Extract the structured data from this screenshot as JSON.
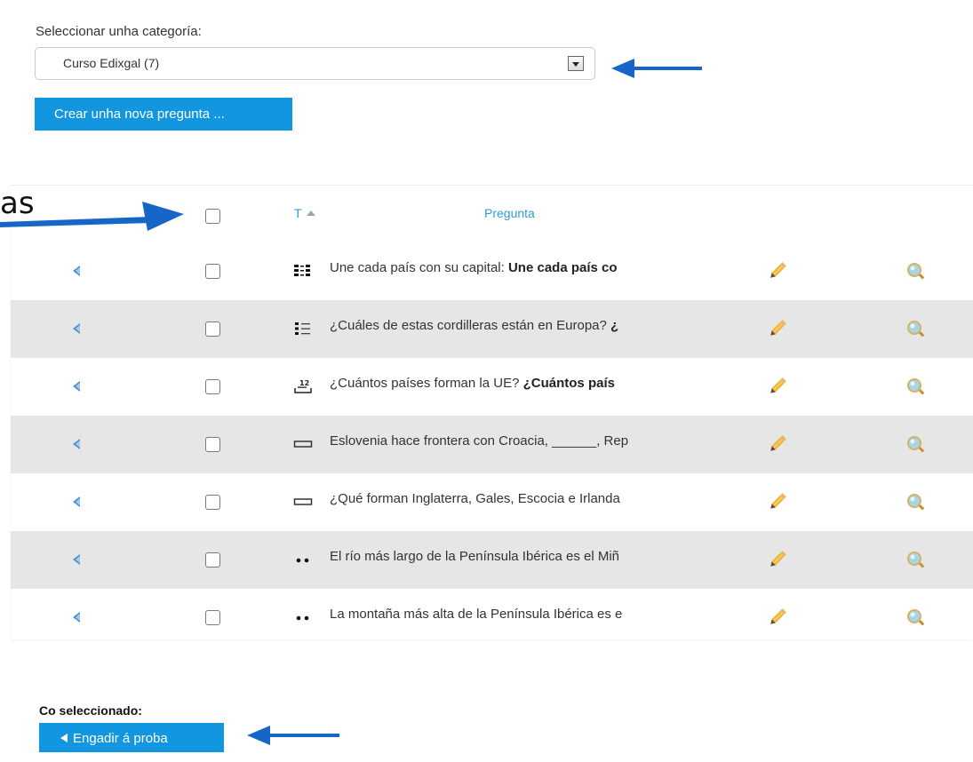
{
  "category": {
    "label": "Seleccionar unha categoría:",
    "selected": "Curso Edixgal (7)"
  },
  "create_button": "Crear unha nova pregunta ...",
  "partial_text": "as",
  "table": {
    "col_type": "T",
    "col_question": "Pregunta",
    "rows": [
      {
        "type_icon": "matching-icon",
        "text": "Une cada país con su capital: ",
        "bold": "Une cada país co"
      },
      {
        "type_icon": "multichoice-icon",
        "text": "¿Cuáles de estas cordilleras están en Europa? ",
        "bold": "¿"
      },
      {
        "type_icon": "numerical-icon",
        "text": "¿Cuántos países forman la UE? ",
        "bold": "¿Cuántos país"
      },
      {
        "type_icon": "shortanswer-icon",
        "text": "Eslovenia hace frontera con Croacia, ______, Rep",
        "bold": ""
      },
      {
        "type_icon": "shortanswer-icon",
        "text": "¿Qué forman Inglaterra, Gales, Escocia e Irlanda",
        "bold": ""
      },
      {
        "type_icon": "truefalse-icon",
        "text": "El río más largo de la Península Ibérica es el Miñ",
        "bold": ""
      },
      {
        "type_icon": "truefalse-icon",
        "text": "La montaña más alta de la Península Ibérica es e",
        "bold": ""
      }
    ]
  },
  "with_selected": {
    "label": "Co seleccionado:",
    "button": "Engadir á proba"
  },
  "colors": {
    "accent": "#1396e0",
    "link": "#2a9fd6",
    "arrow": "#1666c8",
    "row_alt": "#e6e6e6"
  }
}
